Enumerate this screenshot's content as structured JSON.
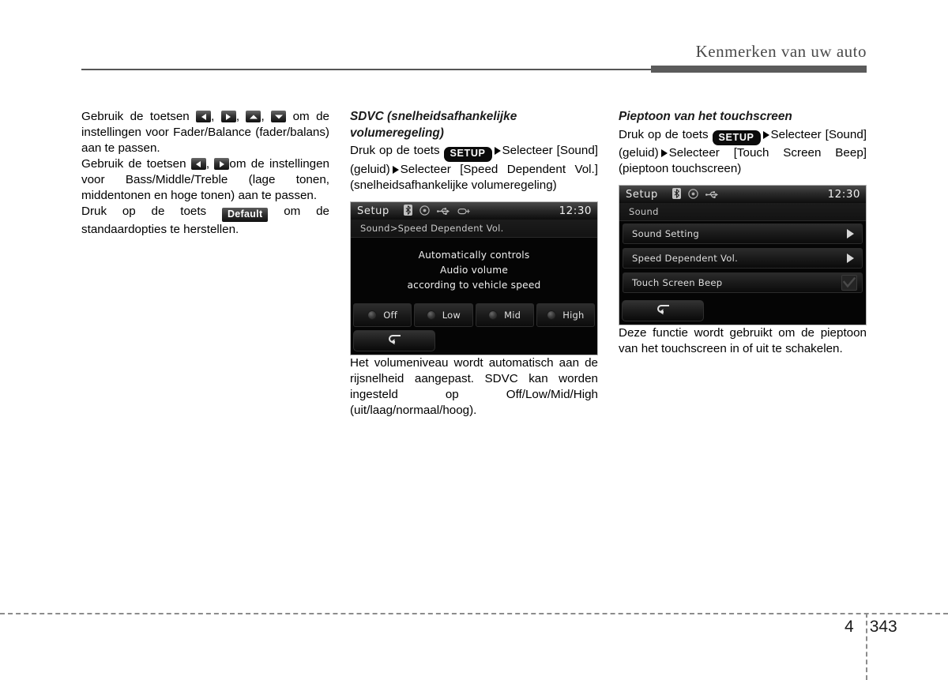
{
  "header": {
    "title": "Kenmerken van uw auto"
  },
  "left_column": {
    "para1_a": "Gebruik de toetsen ",
    "para1_b": ", ",
    "para1_c": ", ",
    "para1_d": ", ",
    "para1_e": " om de instellingen voor Fader/Balance (fader/balans) aan te passen.",
    "para2_a": "Gebruik de toetsen ",
    "para2_b": ", ",
    "para2_c": "om de instellingen voor Bass/Middle/Treble (lage tonen, middentonen en hoge tonen) aan te passen.",
    "para3_a": "Druk op de toets ",
    "default_key": "Default",
    "para3_b": " om de standaardopties te herstellen.",
    "arrow_left_icon": "arrow-left-key-icon",
    "arrow_right_icon": "arrow-right-key-icon",
    "arrow_up_icon": "arrow-up-key-icon",
    "arrow_down_icon": "arrow-down-key-icon"
  },
  "mid_column": {
    "heading": "SDVC (snelheidsafhankelijke volumeregeling)",
    "instr_a": "Druk op de toets ",
    "setup_key": "SETUP",
    "instr_b": "Selecteer [Sound] (geluid)",
    "instr_c": "Selecteer [Speed Dependent Vol.] (snelheidsafhankelijke volumeregeling)",
    "caption": "Het volumeniveau wordt automatisch aan de rijsnelheid aangepast. SDVC kan worden ingesteld op Off/Low/Mid/High (uit/laag/normaal/hoog).",
    "device": {
      "title": "Setup",
      "clock": "12:30",
      "status_icons": [
        "bluetooth-icon",
        "disc-icon",
        "usb-icon",
        "aux-device-icon"
      ],
      "breadcrumb": "Sound>Speed Dependent Vol.",
      "description_lines": [
        "Automatically controls",
        "Audio volume",
        "according to vehicle speed"
      ],
      "options": [
        {
          "label": "Off",
          "selected": false
        },
        {
          "label": "Low",
          "selected": false
        },
        {
          "label": "Mid",
          "selected": false
        },
        {
          "label": "High",
          "selected": false
        }
      ],
      "back_icon": "back-arrow-icon"
    }
  },
  "right_column": {
    "heading": "Pieptoon van het touchscreen",
    "instr_a": "Druk op de toets ",
    "setup_key": "SETUP",
    "instr_b": "Selecteer [Sound] (geluid)",
    "instr_c": "Selecteer [Touch Screen Beep] (pieptoon touchscreen)",
    "caption": "Deze functie wordt gebruikt om de pieptoon van het touchscreen in of uit te schakelen.",
    "device": {
      "title": "Setup",
      "clock": "12:30",
      "status_icons": [
        "bluetooth-icon",
        "disc-icon",
        "usb-icon"
      ],
      "breadcrumb": "Sound",
      "rows": [
        {
          "label": "Sound Setting",
          "control": "chevron"
        },
        {
          "label": "Speed Dependent Vol.",
          "control": "chevron"
        },
        {
          "label": "Touch Screen Beep",
          "control": "checkbox"
        }
      ],
      "back_icon": "back-arrow-icon"
    }
  },
  "footer": {
    "chapter": "4",
    "page": "343"
  }
}
